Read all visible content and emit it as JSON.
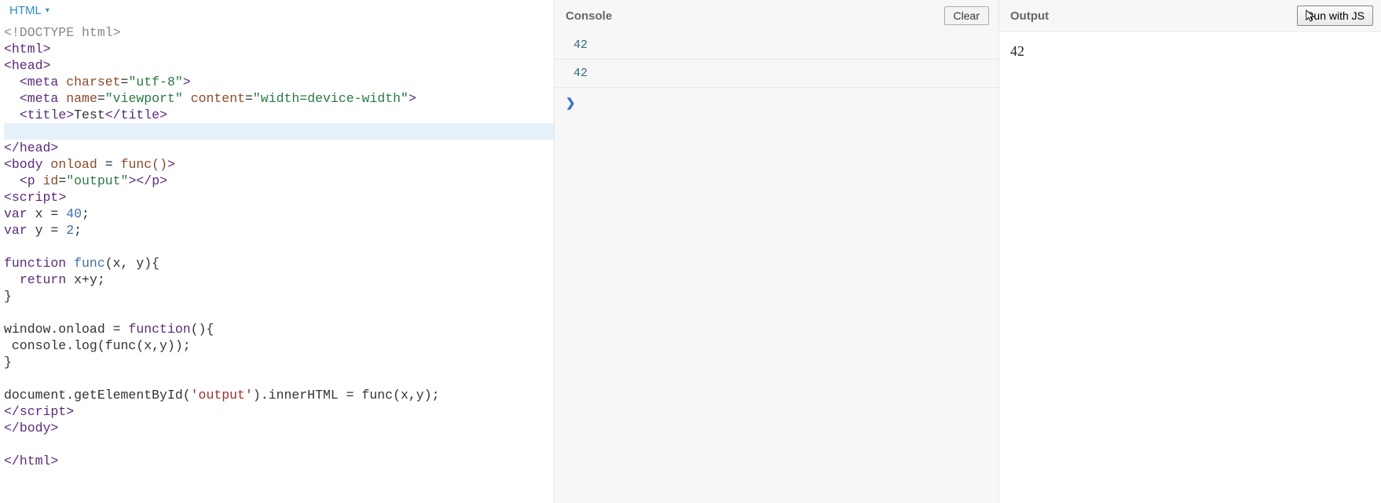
{
  "editor": {
    "lang_label": "HTML",
    "code_lines": [
      {
        "tokens": [
          {
            "t": "<!DOCTYPE html>",
            "c": "tok-doctype"
          }
        ]
      },
      {
        "tokens": [
          {
            "t": "<",
            "c": "tok-bracket"
          },
          {
            "t": "html",
            "c": "tok-tag"
          },
          {
            "t": ">",
            "c": "tok-bracket"
          }
        ]
      },
      {
        "tokens": [
          {
            "t": "<",
            "c": "tok-bracket"
          },
          {
            "t": "head",
            "c": "tok-tag"
          },
          {
            "t": ">",
            "c": "tok-bracket"
          }
        ]
      },
      {
        "tokens": [
          {
            "t": "  ",
            "c": "tok-text"
          },
          {
            "t": "<",
            "c": "tok-bracket"
          },
          {
            "t": "meta",
            "c": "tok-tag"
          },
          {
            "t": " ",
            "c": "tok-text"
          },
          {
            "t": "charset",
            "c": "tok-attr"
          },
          {
            "t": "=",
            "c": "tok-text"
          },
          {
            "t": "\"utf-8\"",
            "c": "tok-string"
          },
          {
            "t": ">",
            "c": "tok-bracket"
          }
        ]
      },
      {
        "tokens": [
          {
            "t": "  ",
            "c": "tok-text"
          },
          {
            "t": "<",
            "c": "tok-bracket"
          },
          {
            "t": "meta",
            "c": "tok-tag"
          },
          {
            "t": " ",
            "c": "tok-text"
          },
          {
            "t": "name",
            "c": "tok-attr"
          },
          {
            "t": "=",
            "c": "tok-text"
          },
          {
            "t": "\"viewport\"",
            "c": "tok-string"
          },
          {
            "t": " ",
            "c": "tok-text"
          },
          {
            "t": "content",
            "c": "tok-attr"
          },
          {
            "t": "=",
            "c": "tok-text"
          },
          {
            "t": "\"width=device-width\"",
            "c": "tok-string"
          },
          {
            "t": ">",
            "c": "tok-bracket"
          }
        ]
      },
      {
        "tokens": [
          {
            "t": "  ",
            "c": "tok-text"
          },
          {
            "t": "<",
            "c": "tok-bracket"
          },
          {
            "t": "title",
            "c": "tok-tag"
          },
          {
            "t": ">",
            "c": "tok-bracket"
          },
          {
            "t": "Test",
            "c": "tok-text"
          },
          {
            "t": "</",
            "c": "tok-bracket"
          },
          {
            "t": "title",
            "c": "tok-tag"
          },
          {
            "t": ">",
            "c": "tok-bracket"
          }
        ]
      },
      {
        "highlight": true,
        "tokens": [
          {
            "t": "  ",
            "c": "tok-text"
          }
        ]
      },
      {
        "tokens": [
          {
            "t": "</",
            "c": "tok-bracket"
          },
          {
            "t": "head",
            "c": "tok-tag"
          },
          {
            "t": ">",
            "c": "tok-bracket"
          }
        ]
      },
      {
        "tokens": [
          {
            "t": "<",
            "c": "tok-bracket"
          },
          {
            "t": "body",
            "c": "tok-tag"
          },
          {
            "t": " ",
            "c": "tok-text"
          },
          {
            "t": "onload",
            "c": "tok-attr"
          },
          {
            "t": " = ",
            "c": "tok-text"
          },
          {
            "t": "func()",
            "c": "tok-attr"
          },
          {
            "t": ">",
            "c": "tok-bracket"
          }
        ]
      },
      {
        "tokens": [
          {
            "t": "  ",
            "c": "tok-text"
          },
          {
            "t": "<",
            "c": "tok-bracket"
          },
          {
            "t": "p",
            "c": "tok-tag"
          },
          {
            "t": " ",
            "c": "tok-text"
          },
          {
            "t": "id",
            "c": "tok-attr"
          },
          {
            "t": "=",
            "c": "tok-text"
          },
          {
            "t": "\"output\"",
            "c": "tok-string"
          },
          {
            "t": "></",
            "c": "tok-bracket"
          },
          {
            "t": "p",
            "c": "tok-tag"
          },
          {
            "t": ">",
            "c": "tok-bracket"
          }
        ]
      },
      {
        "tokens": [
          {
            "t": "<",
            "c": "tok-bracket"
          },
          {
            "t": "script",
            "c": "tok-tag"
          },
          {
            "t": ">",
            "c": "tok-bracket"
          }
        ]
      },
      {
        "tokens": [
          {
            "t": "var",
            "c": "tok-keyword"
          },
          {
            "t": " x = ",
            "c": "tok-text"
          },
          {
            "t": "40",
            "c": "tok-num"
          },
          {
            "t": ";",
            "c": "tok-text"
          }
        ]
      },
      {
        "tokens": [
          {
            "t": "var",
            "c": "tok-keyword"
          },
          {
            "t": " y = ",
            "c": "tok-text"
          },
          {
            "t": "2",
            "c": "tok-num"
          },
          {
            "t": ";",
            "c": "tok-text"
          }
        ]
      },
      {
        "tokens": []
      },
      {
        "tokens": [
          {
            "t": "function",
            "c": "tok-keyword"
          },
          {
            "t": " ",
            "c": "tok-text"
          },
          {
            "t": "func",
            "c": "tok-func"
          },
          {
            "t": "(x, y){",
            "c": "tok-text"
          }
        ]
      },
      {
        "tokens": [
          {
            "t": "  ",
            "c": "tok-text"
          },
          {
            "t": "return",
            "c": "tok-keyword"
          },
          {
            "t": " x+y;",
            "c": "tok-text"
          }
        ]
      },
      {
        "tokens": [
          {
            "t": "}",
            "c": "tok-text"
          }
        ]
      },
      {
        "tokens": []
      },
      {
        "tokens": [
          {
            "t": "window.onload = ",
            "c": "tok-text"
          },
          {
            "t": "function",
            "c": "tok-keyword"
          },
          {
            "t": "(){",
            "c": "tok-text"
          }
        ]
      },
      {
        "tokens": [
          {
            "t": " console.log(func(x,y));",
            "c": "tok-text"
          }
        ]
      },
      {
        "tokens": [
          {
            "t": "}",
            "c": "tok-text"
          }
        ]
      },
      {
        "tokens": []
      },
      {
        "tokens": [
          {
            "t": "document.getElementById(",
            "c": "tok-text"
          },
          {
            "t": "'output'",
            "c": "tok-strq"
          },
          {
            "t": ").innerHTML = func(x,y);",
            "c": "tok-text"
          }
        ]
      },
      {
        "tokens": [
          {
            "t": "</",
            "c": "tok-bracket"
          },
          {
            "t": "script",
            "c": "tok-tag"
          },
          {
            "t": ">",
            "c": "tok-bracket"
          }
        ]
      },
      {
        "tokens": [
          {
            "t": "</",
            "c": "tok-bracket"
          },
          {
            "t": "body",
            "c": "tok-tag"
          },
          {
            "t": ">",
            "c": "tok-bracket"
          }
        ]
      },
      {
        "tokens": []
      },
      {
        "tokens": [
          {
            "t": "</",
            "c": "tok-bracket"
          },
          {
            "t": "html",
            "c": "tok-tag"
          },
          {
            "t": ">",
            "c": "tok-bracket"
          }
        ]
      }
    ]
  },
  "console": {
    "title": "Console",
    "clear_label": "Clear",
    "rows": [
      "42",
      "42"
    ],
    "prompt": "❯"
  },
  "output": {
    "title": "Output",
    "run_label": "Run with JS",
    "body": "42"
  }
}
